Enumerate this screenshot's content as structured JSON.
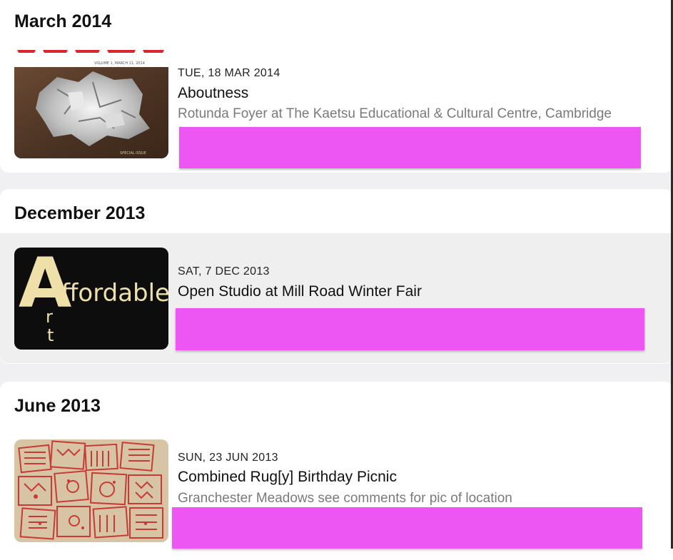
{
  "sections": [
    {
      "heading": "March 2014",
      "events": [
        {
          "date": "TUE, 18 MAR 2014",
          "title": "Aboutness",
          "location": "Rotunda Foyer at The Kaetsu Educational & Cultural Centre, Cambridge",
          "thumb": {
            "masthead": "VOLUME 1, MARCH 11, 2014",
            "footer": "SPECIAL ISSUE"
          }
        }
      ]
    },
    {
      "heading": "December 2013",
      "events": [
        {
          "date": "SAT, 7 DEC 2013",
          "title": "Open Studio at Mill Road Winter Fair",
          "thumb": {
            "big_letter_1": "A",
            "word": "ffordable",
            "letters": [
              "r",
              "t"
            ]
          }
        }
      ]
    },
    {
      "heading": "June 2013",
      "events": [
        {
          "date": "SUN, 23 JUN 2013",
          "title": "Combined Rug[y] Birthday Picnic",
          "location": "Granchester Meadows see comments for pic of location"
        }
      ]
    }
  ],
  "colors": {
    "redaction": "#ed56f3",
    "page_background": "#f0f0f3",
    "highlight_row": "#efeff0"
  }
}
